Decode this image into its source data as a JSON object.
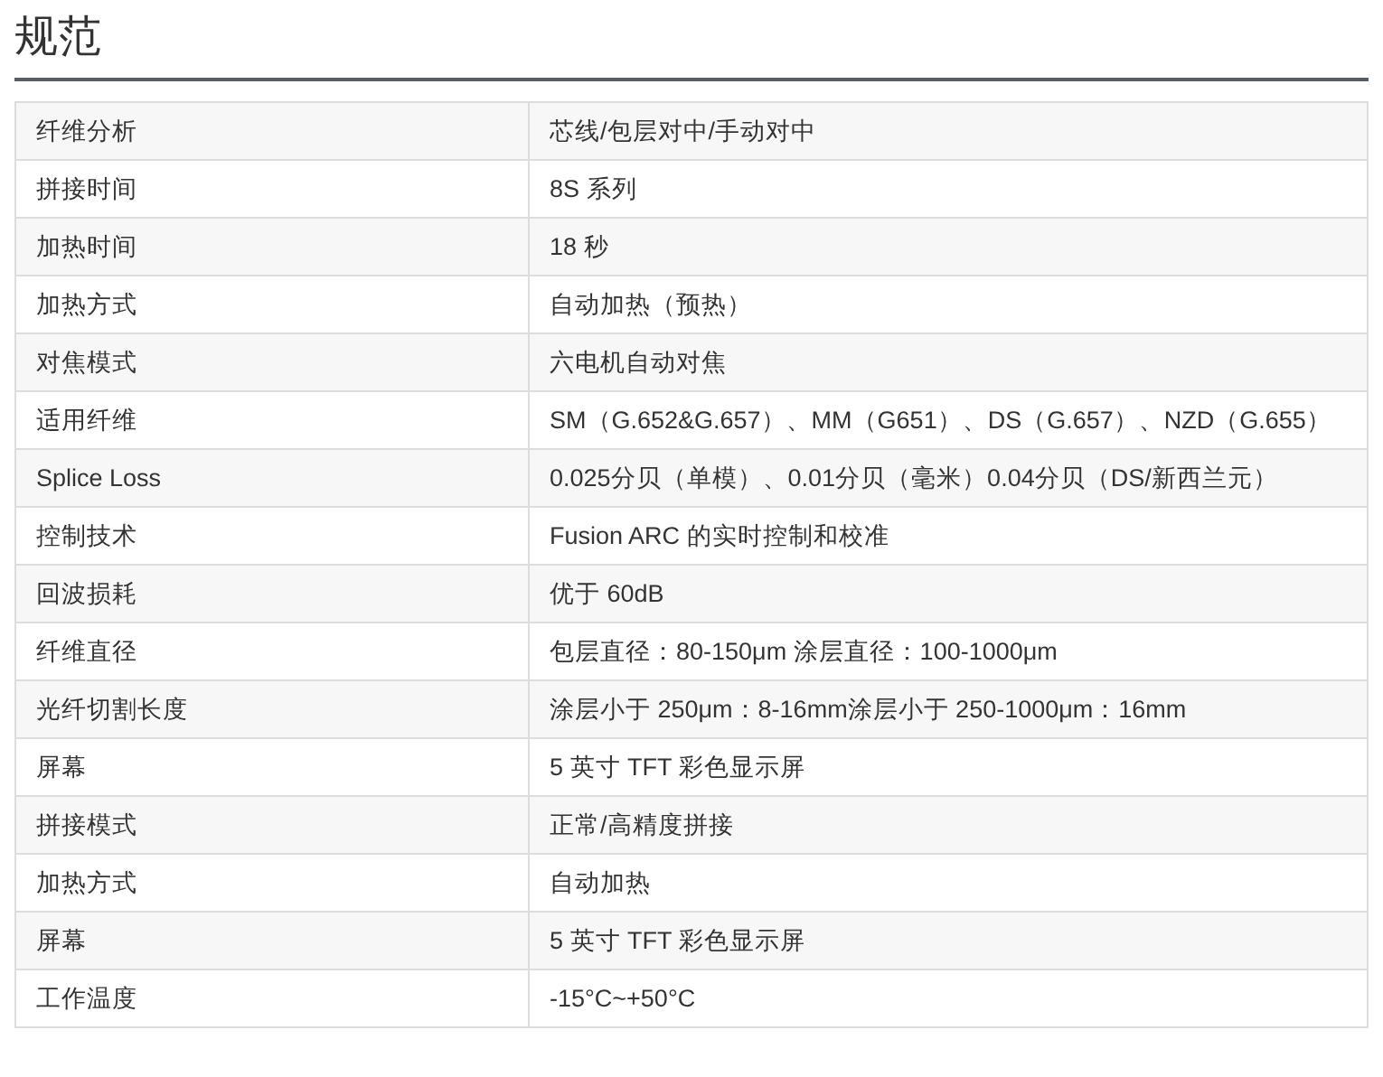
{
  "title": "规范",
  "table": {
    "rows": [
      {
        "label": "纤维分析",
        "value": "芯线/包层对中/手动对中"
      },
      {
        "label": "拼接时间",
        "value": "8S 系列"
      },
      {
        "label": "加热时间",
        "value": "18 秒"
      },
      {
        "label": "加热方式",
        "value": "自动加热（预热）"
      },
      {
        "label": "对焦模式",
        "value": "六电机自动对焦"
      },
      {
        "label": "适用纤维",
        "value": "SM（G.652&G.657）、MM（G651）、DS（G.657）、NZD（G.655）"
      },
      {
        "label": "Splice Loss",
        "value": "0.025分贝（单模）、0.01分贝（毫米）0.04分贝（DS/新西兰元）"
      },
      {
        "label": "控制技术",
        "value": "Fusion ARC 的实时控制和校准"
      },
      {
        "label": "回波损耗",
        "value": "优于 60dB"
      },
      {
        "label": "纤维直径",
        "value": "包层直径：80-150μm 涂层直径：100-1000μm"
      },
      {
        "label": "光纤切割长度",
        "value": "涂层小于 250μm：8-16mm涂层小于 250-1000μm：16mm"
      },
      {
        "label": "屏幕",
        "value": "5 英寸 TFT 彩色显示屏"
      },
      {
        "label": "拼接模式",
        "value": "正常/高精度拼接"
      },
      {
        "label": "加热方式",
        "value": "自动加热"
      },
      {
        "label": "屏幕",
        "value": "5 英寸 TFT 彩色显示屏"
      },
      {
        "label": "工作温度",
        "value": "-15°C~+50°C"
      }
    ]
  }
}
